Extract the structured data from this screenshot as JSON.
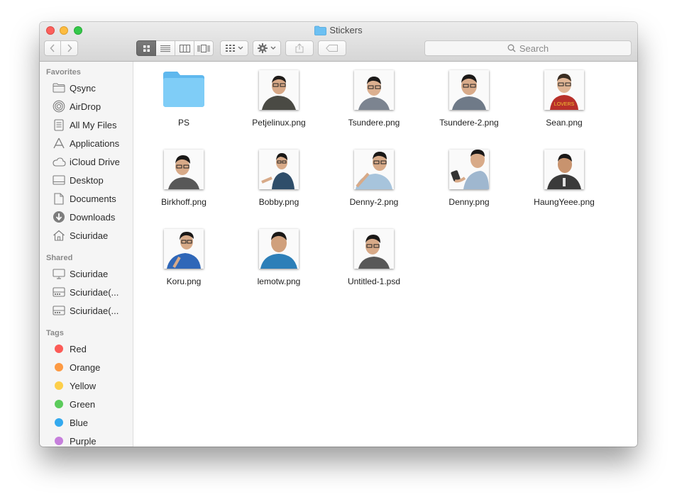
{
  "window": {
    "title": "Stickers"
  },
  "toolbar": {
    "back_icon": "chevron-left-icon",
    "forward_icon": "chevron-right-icon",
    "view_modes": [
      "icon-view-icon",
      "list-view-icon",
      "column-view-icon",
      "cover-flow-icon"
    ],
    "active_view": "icon-view-icon",
    "search_placeholder": "Search"
  },
  "sidebar": {
    "favorites_label": "Favorites",
    "favorites": [
      {
        "label": "Qsync",
        "icon": "folder-icon"
      },
      {
        "label": "AirDrop",
        "icon": "airdrop-icon"
      },
      {
        "label": "All My Files",
        "icon": "all-files-icon"
      },
      {
        "label": "Applications",
        "icon": "applications-icon"
      },
      {
        "label": "iCloud Drive",
        "icon": "cloud-icon"
      },
      {
        "label": "Desktop",
        "icon": "desktop-icon"
      },
      {
        "label": "Documents",
        "icon": "documents-icon"
      },
      {
        "label": "Downloads",
        "icon": "downloads-icon"
      },
      {
        "label": "Sciuridae",
        "icon": "home-icon"
      }
    ],
    "shared_label": "Shared",
    "shared": [
      {
        "label": "Sciuridae",
        "icon": "computer-icon"
      },
      {
        "label": "Sciuridae(...",
        "icon": "server-icon"
      },
      {
        "label": "Sciuridae(...",
        "icon": "server-icon"
      }
    ],
    "tags_label": "Tags",
    "tags": [
      {
        "label": "Red",
        "color": "#fc5b57"
      },
      {
        "label": "Orange",
        "color": "#fd9a43"
      },
      {
        "label": "Yellow",
        "color": "#fdcf4a"
      },
      {
        "label": "Green",
        "color": "#5bcb5b"
      },
      {
        "label": "Blue",
        "color": "#33a9ee"
      },
      {
        "label": "Purple",
        "color": "#c67fdc"
      }
    ]
  },
  "files": [
    {
      "name": "PS",
      "kind": "folder"
    },
    {
      "name": "Petjelinux.png",
      "kind": "image"
    },
    {
      "name": "Tsundere.png",
      "kind": "image"
    },
    {
      "name": "Tsundere-2.png",
      "kind": "image"
    },
    {
      "name": "Sean.png",
      "kind": "image"
    },
    {
      "name": "Birkhoff.png",
      "kind": "image"
    },
    {
      "name": "Bobby.png",
      "kind": "image"
    },
    {
      "name": "Denny-2.png",
      "kind": "image"
    },
    {
      "name": "Denny.png",
      "kind": "image"
    },
    {
      "name": "HaungYeee.png",
      "kind": "image"
    },
    {
      "name": "Koru.png",
      "kind": "image"
    },
    {
      "name": "lemotw.png",
      "kind": "image"
    },
    {
      "name": "Untitled-1.psd",
      "kind": "image"
    }
  ]
}
